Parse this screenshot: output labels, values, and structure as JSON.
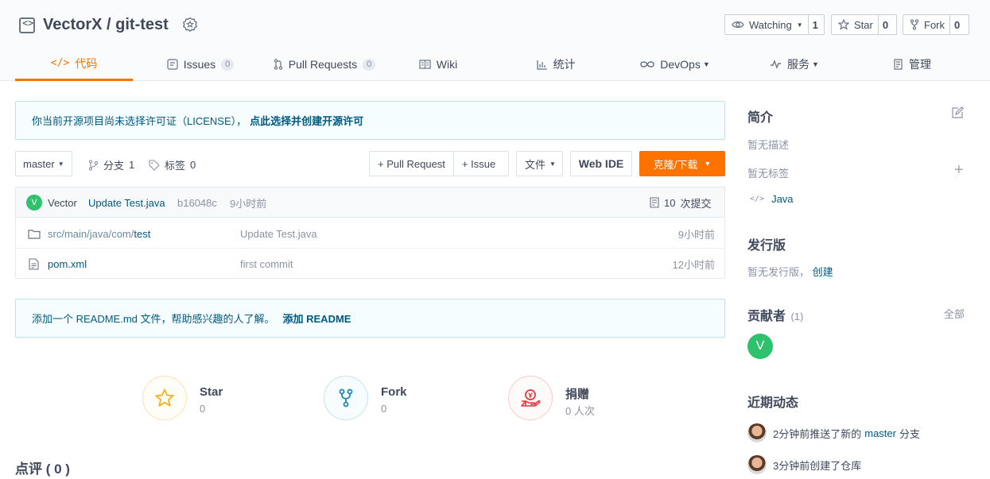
{
  "repo": {
    "owner": "VectorX",
    "separator": " / ",
    "name": "git-test"
  },
  "header_buttons": {
    "watching_label": "Watching",
    "watching_count": "1",
    "star_label": "Star",
    "star_count": "0",
    "fork_label": "Fork",
    "fork_count": "0"
  },
  "tabs": [
    {
      "label": "代码",
      "icon": "code-icon",
      "active": true
    },
    {
      "label": "Issues",
      "count": "0",
      "icon": "issues-icon"
    },
    {
      "label": "Pull Requests",
      "count": "0",
      "icon": "pull-request-icon"
    },
    {
      "label": "Wiki",
      "icon": "wiki-icon"
    },
    {
      "label": "统计",
      "icon": "stats-icon"
    },
    {
      "label": "DevOps",
      "icon": "devops-icon",
      "dropdown": true
    },
    {
      "label": "服务",
      "icon": "service-icon",
      "dropdown": true
    },
    {
      "label": "管理",
      "icon": "manage-icon"
    }
  ],
  "license_notice": {
    "text": "你当前开源项目尚未选择许可证（LICENSE），",
    "link": "点此选择并创建开源许可"
  },
  "toolbar": {
    "branch": "master",
    "branches_label": "分支",
    "branches_count": "1",
    "tags_label": "标签",
    "tags_count": "0",
    "pull_request_button": "+ Pull Request",
    "issue_button": "+ Issue",
    "file_button": "文件",
    "web_ide_button": "Web IDE",
    "clone_button": "克隆/下载"
  },
  "last_commit": {
    "avatar_letter": "V",
    "author": "Vector",
    "message": "Update Test.java",
    "hash": "b16048c",
    "time": "9小时前",
    "commits_count": "10",
    "commits_label": "次提交"
  },
  "files": [
    {
      "icon": "folder-icon",
      "path_prefix": "src/main/java/com/",
      "name": "test",
      "message": "Update Test.java",
      "time": "9小时前"
    },
    {
      "icon": "file-icon",
      "path_prefix": "",
      "name": "pom.xml",
      "message": "first commit",
      "time": "12小时前"
    }
  ],
  "readme_notice": {
    "text": "添加一个 README.md 文件，帮助感兴趣的人了解。",
    "link": "添加 README"
  },
  "stats": {
    "star_title": "Star",
    "star_value": "0",
    "fork_title": "Fork",
    "fork_value": "0",
    "donate_title": "捐赠",
    "donate_value": "0 人次"
  },
  "comments_heading": "点评 ( 0 )",
  "sidebar": {
    "intro_heading": "简介",
    "no_description": "暂无描述",
    "no_tags": "暂无标签",
    "language": "Java",
    "releases_heading": "发行版",
    "no_releases": "暂无发行版，",
    "create_link": "创建",
    "contributors_heading": "贡献者",
    "contributors_count": "(1)",
    "all_link": "全部",
    "contributor_letter": "V",
    "activity_heading": "近期动态",
    "activity": [
      {
        "prefix": "2分钟前推送了新的",
        "branch": "master",
        "suffix": "分支"
      },
      {
        "prefix": "3分钟前创建了仓库",
        "branch": "",
        "suffix": ""
      }
    ]
  },
  "colors": {
    "accent": "#fe7300",
    "link": "#005980",
    "green": "#2dc26b"
  }
}
